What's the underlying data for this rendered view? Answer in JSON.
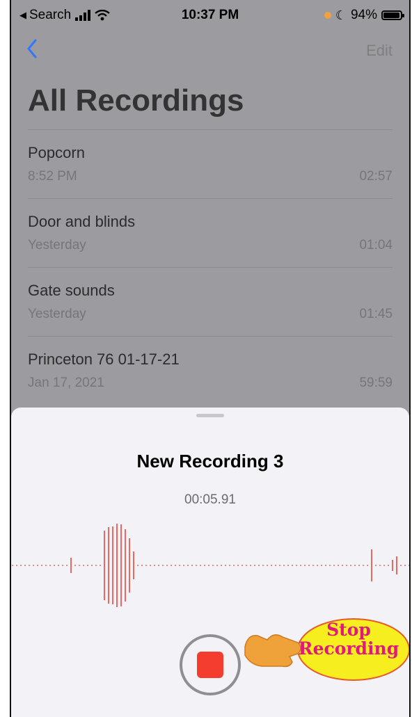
{
  "status_bar": {
    "back_app": "Search",
    "time": "10:37 PM",
    "battery": "94%",
    "battery_level": 0.94
  },
  "nav": {
    "back_icon": "chevron-left-icon",
    "edit_label": "Edit"
  },
  "page_title": "All Recordings",
  "recordings": [
    {
      "name": "Popcorn",
      "date": "8:52 PM",
      "duration": "02:57"
    },
    {
      "name": "Door and blinds",
      "date": "Yesterday",
      "duration": "01:04"
    },
    {
      "name": "Gate sounds",
      "date": "Yesterday",
      "duration": "01:45"
    },
    {
      "name": "Princeton 76 01-17-21",
      "date": "Jan 17, 2021",
      "duration": "59:59"
    }
  ],
  "recording_sheet": {
    "title": "New Recording 3",
    "elapsed": "00:05.91",
    "stop_icon": "stop-icon"
  },
  "annotation": {
    "line1": "Stop",
    "line2": "Recording"
  },
  "colors": {
    "accent_blue": "#3478f6",
    "record_red": "#f53d2f",
    "waveform_red": "#e8463a",
    "callout_yellow": "#f7ee1f",
    "callout_text": "#e0197c",
    "arrow_orange": "#f0a23a"
  }
}
